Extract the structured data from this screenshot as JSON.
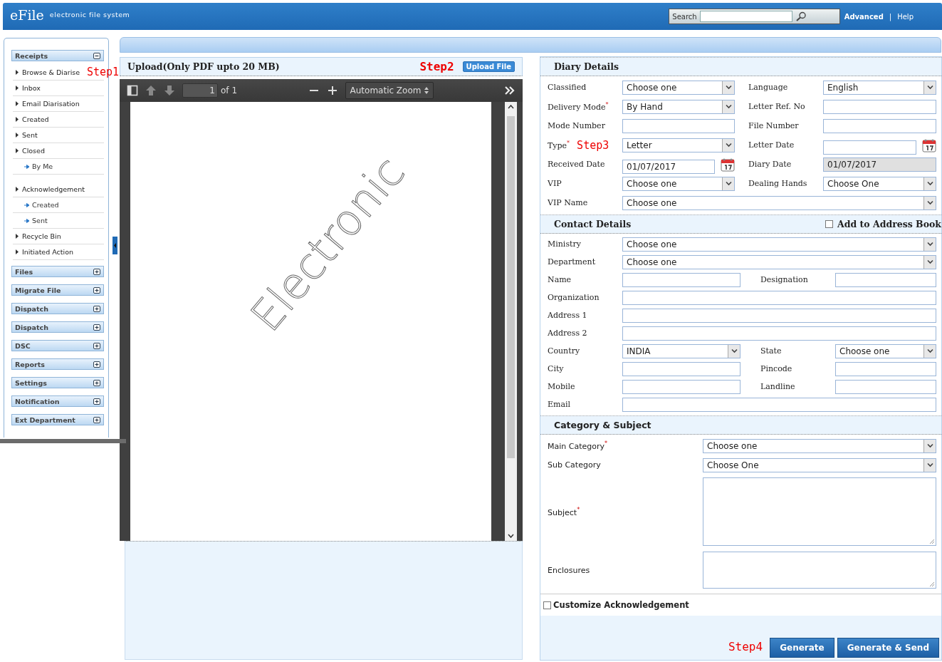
{
  "header": {
    "logo": "eFile",
    "tagline": "electronic file system",
    "search": {
      "label": "Search"
    },
    "links": [
      "Advanced",
      "Help"
    ],
    "separator": "|"
  },
  "sidebar": {
    "sections": [
      {
        "label": "Receipts",
        "expanded": true,
        "items": [
          {
            "label": "Browse & Diarise",
            "annotation": "Step1"
          },
          {
            "label": "Inbox"
          },
          {
            "label": "Email Diarisation"
          },
          {
            "label": "Created"
          },
          {
            "label": "Sent"
          },
          {
            "label": "Closed",
            "children": [
              {
                "label": "By Me"
              }
            ]
          },
          {
            "label": "Acknowledgement",
            "children": [
              {
                "label": "Created"
              },
              {
                "label": "Sent"
              }
            ]
          },
          {
            "label": "Recycle Bin"
          },
          {
            "label": "Initiated Action"
          }
        ]
      },
      {
        "label": "Files",
        "expanded": false
      },
      {
        "label": "Migrate File",
        "expanded": false
      },
      {
        "label": "Dispatch",
        "expanded": false
      },
      {
        "label": "Dispatch",
        "expanded": false
      },
      {
        "label": "DSC",
        "expanded": false
      },
      {
        "label": "Reports",
        "expanded": false
      },
      {
        "label": "Settings",
        "expanded": false
      },
      {
        "label": "Notification",
        "expanded": false
      },
      {
        "label": "Ext Department",
        "expanded": false
      }
    ]
  },
  "upload": {
    "title": "Upload(Only PDF upto 20 MB)",
    "annotation": "Step2",
    "button": "Upload File",
    "viewer": {
      "page": "1",
      "page_count": "of 1",
      "zoom": "Automatic Zoom",
      "page_text": "Electronic"
    }
  },
  "form": {
    "sections": [
      {
        "kind": "diary",
        "title": "Diary Details",
        "rows": [
          [
            {
              "label": "Classified",
              "kind": "select",
              "value": "Choose one"
            },
            {
              "label": "Language",
              "kind": "select",
              "value": "English"
            }
          ],
          [
            {
              "label": "Delivery Mode$^{*}$",
              "kind": "select",
              "value": "By Hand"
            },
            {
              "label": "Letter Ref. No",
              "kind": "input"
            }
          ],
          [
            {
              "label": "Mode Number",
              "kind": "input"
            },
            {
              "label": "File Number",
              "kind": "input"
            }
          ],
          [
            {
              "label": "Type$^{*}$",
              "annotation": "Step3",
              "kind": "select",
              "value": "Letter"
            },
            {
              "label": "Letter Date",
              "kind": "date"
            }
          ],
          [
            {
              "label": "Received Date",
              "kind": "date",
              "value": "01/07/2017"
            },
            {
              "label": "Diary Date",
              "kind": "readonly",
              "value": "01/07/2017"
            }
          ],
          [
            {
              "label": "VIP",
              "kind": "select",
              "value": "Choose one"
            },
            {
              "label": "Dealing Hands",
              "kind": "select",
              "value": "Choose One"
            }
          ],
          [
            {
              "label": "VIP Name",
              "kind": "select",
              "value": "Choose one"
            }
          ]
        ]
      },
      {
        "kind": "contact",
        "title": "Contact Details",
        "checkbox": {
          "label": "Add to Address Book",
          "checked": false
        },
        "rows": [
          [
            {
              "label": "Ministry",
              "kind": "select",
              "value": "Choose one"
            }
          ],
          [
            {
              "label": "Department",
              "kind": "select",
              "value": "Choose one"
            }
          ],
          [
            {
              "label": "Name",
              "kind": "input"
            },
            {
              "label": "Designation",
              "kind": "input"
            }
          ],
          [
            {
              "label": "Organization",
              "kind": "input"
            }
          ],
          [
            {
              "label": "Address 1",
              "kind": "input"
            }
          ],
          [
            {
              "label": "Address 2",
              "kind": "input"
            }
          ],
          [
            {
              "label": "Country",
              "kind": "select",
              "value": "INDIA"
            },
            {
              "label": "State",
              "kind": "select",
              "value": "Choose one"
            }
          ],
          [
            {
              "label": "City",
              "kind": "input"
            },
            {
              "label": "Pincode",
              "kind": "input"
            }
          ],
          [
            {
              "label": "Mobile",
              "kind": "input"
            },
            {
              "label": "Landline",
              "kind": "input"
            }
          ],
          [
            {
              "label": "Email",
              "kind": "input"
            }
          ]
        ]
      },
      {
        "kind": "category",
        "title": "Category & Subject",
        "rows": [
          [
            {
              "label": "Main Category$^{*}$",
              "kind": "select",
              "value": "Choose one"
            }
          ],
          [
            {
              "label": "Sub Category",
              "kind": "select",
              "value": "Choose One"
            }
          ],
          [
            {
              "label": "Subject$^{*}$",
              "kind": "textarea"
            }
          ],
          [
            {
              "label": "Enclosures",
              "kind": "textarea"
            }
          ]
        ]
      }
    ],
    "acknowledgement": {
      "label": "Customize Acknowledgement",
      "checked": false
    },
    "annotation": "Step4",
    "buttons": [
      "Generate",
      "Generate & Send"
    ]
  }
}
